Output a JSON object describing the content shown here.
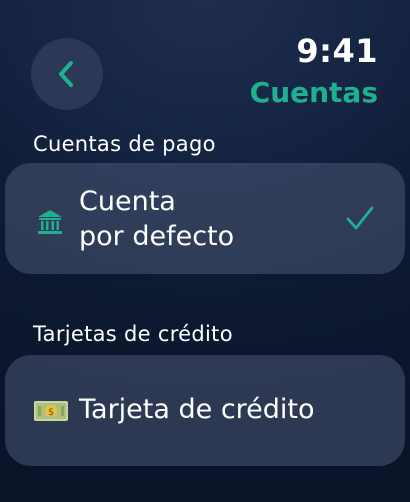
{
  "header": {
    "time": "9:41",
    "title": "Cuentas",
    "back_icon": "chevron-left-icon"
  },
  "sections": {
    "payment": {
      "header": "Cuentas de pago",
      "item": {
        "line1": "Cuenta",
        "line2": "por defecto",
        "icon": "bank-icon",
        "selected": true
      }
    },
    "credit": {
      "header": "Tarjetas de crédito",
      "item": {
        "label": "Tarjeta de crédito",
        "icon": "money-icon"
      }
    }
  },
  "colors": {
    "accent": "#1fb08f",
    "card": "#4a5774",
    "background": "#0e1a33"
  }
}
